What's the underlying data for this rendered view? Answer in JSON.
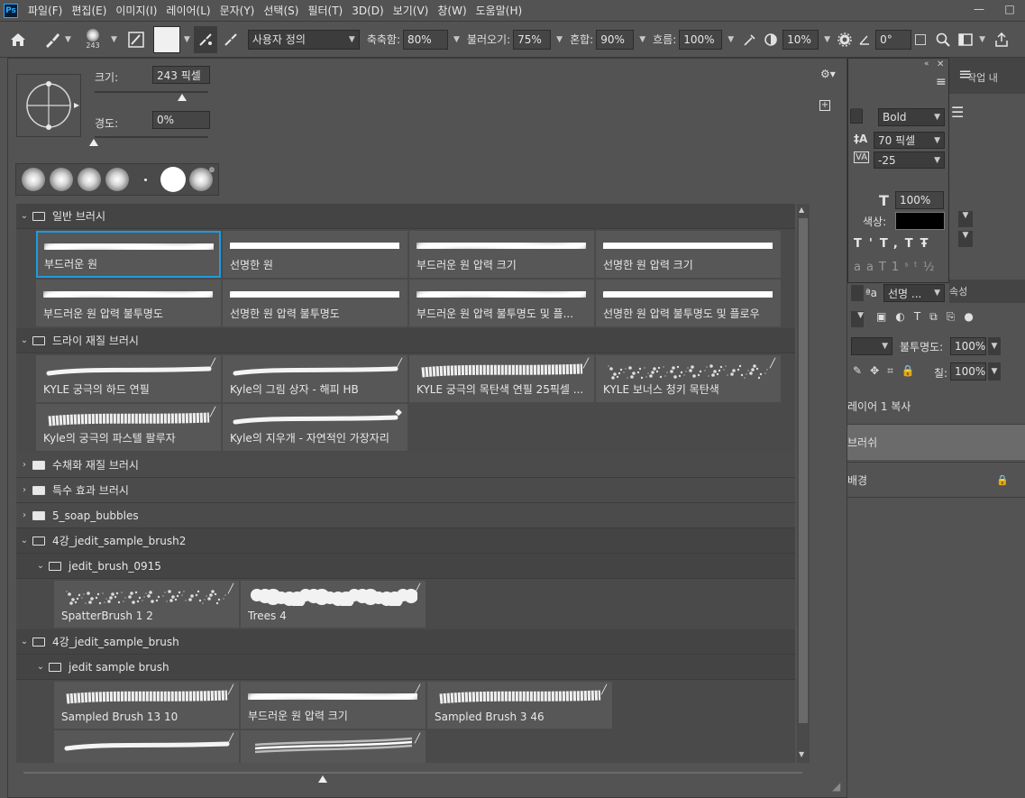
{
  "app": {
    "logo": "Ps"
  },
  "menu": [
    "파일(F)",
    "편집(E)",
    "이미지(I)",
    "레이어(L)",
    "문자(Y)",
    "선택(S)",
    "필터(T)",
    "3D(D)",
    "보기(V)",
    "창(W)",
    "도움말(H)"
  ],
  "window_controls": {
    "minimize": "—",
    "maximize": "□"
  },
  "options": {
    "brush_size": "243",
    "mode": "사용자 정의",
    "smooth_label": "축축함:",
    "smooth_value": "80%",
    "load_label": "불러오기:",
    "load_value": "75%",
    "mix_label": "혼합:",
    "mix_value": "90%",
    "flow_label": "흐름:",
    "flow_value": "100%",
    "extra_value": "10%",
    "angle_value": "0°"
  },
  "brush_panel": {
    "size_label": "크기:",
    "size_value": "243 픽셀",
    "hardness_label": "경도:",
    "hardness_value": "0%",
    "groups": [
      {
        "name": "일반 브러시",
        "expanded": true,
        "tiles": [
          {
            "name": "부드러운 원",
            "style": "soft",
            "selected": true
          },
          {
            "name": "선명한 원",
            "style": "hard"
          },
          {
            "name": "부드러운 원 압력 크기",
            "style": "soft"
          },
          {
            "name": "선명한 원 압력 크기",
            "style": "hard"
          },
          {
            "name": "부드러운 원 압력 불투명도",
            "style": "soft"
          },
          {
            "name": "선명한 원 압력 불투명도",
            "style": "hard"
          },
          {
            "name": "부드러운 원 압력 불투명도 및 플...",
            "style": "soft"
          },
          {
            "name": "선명한 원 압력 불투명도 및 플로우",
            "style": "hard"
          }
        ]
      },
      {
        "name": "드라이 재질 브러시",
        "expanded": true,
        "tiles": [
          {
            "name": "KYLE 궁극의 하드 연필",
            "style": "pencil",
            "icon": "brush-icon"
          },
          {
            "name": "Kyle의 그림 상자 - 해피 HB",
            "style": "pencil",
            "icon": "brush-icon"
          },
          {
            "name": "KYLE 궁극의 목탄색 연필 25픽셀 ...",
            "style": "charcoal",
            "icon": "brush-icon"
          },
          {
            "name": "KYLE 보너스 청키 목탄색",
            "style": "speckle",
            "icon": "brush-icon"
          },
          {
            "name": "Kyle의 궁극의 파스텔 팔루자",
            "style": "charcoal",
            "icon": "brush-icon"
          },
          {
            "name": "Kyle의 지우개 - 자연적인 가장자리",
            "style": "pencil",
            "icon": "eraser-icon"
          }
        ]
      },
      {
        "name": "수채화 재질 브러시",
        "expanded": false,
        "tiles": []
      },
      {
        "name": "특수 효과 브러시",
        "expanded": false,
        "tiles": []
      },
      {
        "name": "5_soap_bubbles",
        "expanded": false,
        "tiles": []
      },
      {
        "name": "4강_jedit_sample_brush2",
        "expanded": true,
        "sub": "jedit_brush_0915",
        "tiles": [
          {
            "name": "SpatterBrush 1 2",
            "style": "speckle",
            "icon": "brush-icon"
          },
          {
            "name": "Trees 4",
            "style": "cloud",
            "icon": "brush-icon"
          }
        ]
      },
      {
        "name": "4강_jedit_sample_brush",
        "expanded": true,
        "sub": "jedit sample brush",
        "tiles": [
          {
            "name": "Sampled Brush 13 10",
            "style": "charcoal",
            "icon": "brush-icon"
          },
          {
            "name": "부드러운 원 압력 크기",
            "style": "soft",
            "icon": "brush-icon"
          },
          {
            "name": "Sampled Brush 3 46",
            "style": "charcoal",
            "icon": "brush-icon"
          },
          {
            "name": "",
            "style": "pencil",
            "icon": "brush-icon"
          },
          {
            "name": "",
            "style": "streak",
            "icon": "brush-icon"
          }
        ]
      }
    ]
  },
  "character": {
    "tab_work": "작업 내",
    "font_style": "Bold",
    "leading": "70 픽셀",
    "tracking": "-25",
    "scale": "100%",
    "color_label": "색상:",
    "aa_value": "선명 ...",
    "props_tab": "속성"
  },
  "layers": {
    "opacity_label": "불투명도:",
    "opacity_value": "100%",
    "fill_label": "칠:",
    "fill_value": "100%",
    "items": [
      {
        "name": "레이어 1 복사"
      },
      {
        "name": "브러쉬"
      },
      {
        "name": "배경"
      }
    ]
  },
  "colors": {
    "accent": "#1f9bde",
    "panel": "#535353",
    "dark": "#282828"
  }
}
